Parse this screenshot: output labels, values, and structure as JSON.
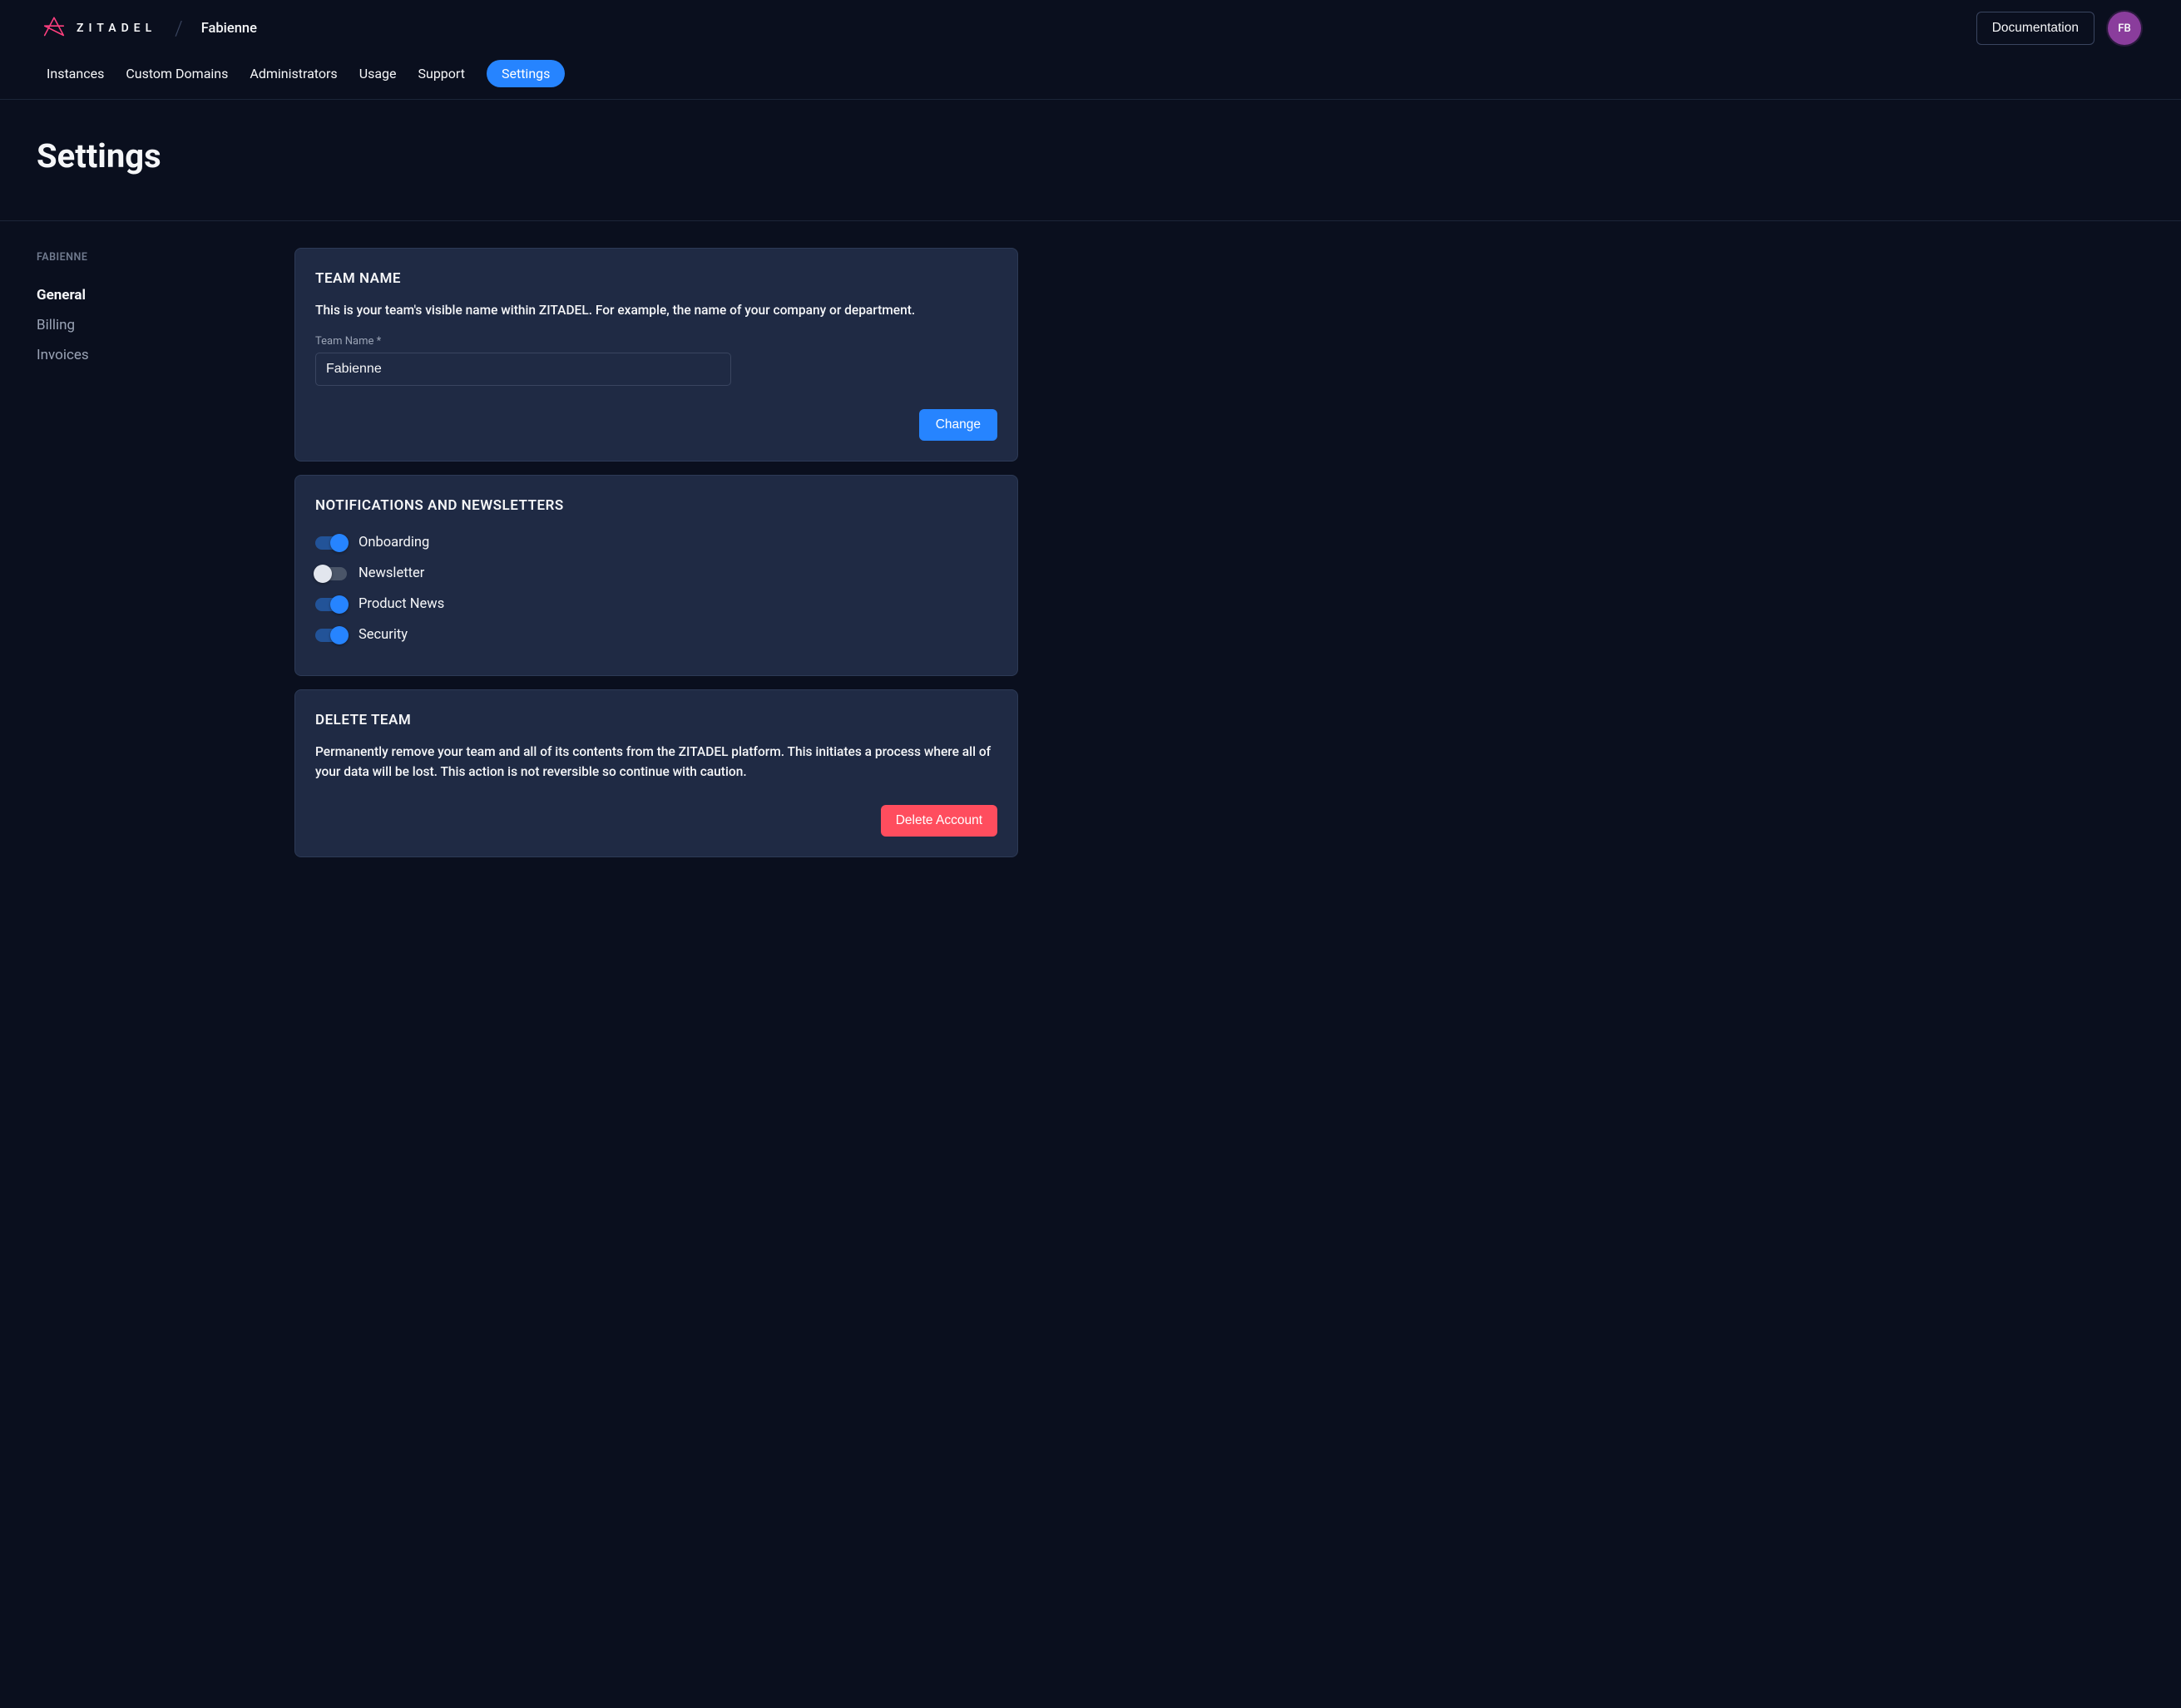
{
  "header": {
    "brand_text": "ZITADEL",
    "breadcrumb": "Fabienne",
    "documentation_label": "Documentation",
    "avatar_initials": "FB"
  },
  "nav": {
    "items": [
      {
        "label": "Instances",
        "active": false
      },
      {
        "label": "Custom Domains",
        "active": false
      },
      {
        "label": "Administrators",
        "active": false
      },
      {
        "label": "Usage",
        "active": false
      },
      {
        "label": "Support",
        "active": false
      },
      {
        "label": "Settings",
        "active": true
      }
    ]
  },
  "page": {
    "title": "Settings"
  },
  "sidebar": {
    "heading": "FABIENNE",
    "items": [
      {
        "label": "General",
        "active": true
      },
      {
        "label": "Billing",
        "active": false
      },
      {
        "label": "Invoices",
        "active": false
      }
    ]
  },
  "team_name_card": {
    "title": "TEAM NAME",
    "description": "This is your team's visible name within ZITADEL. For example, the name of your company or department.",
    "field_label": "Team Name *",
    "field_value": "Fabienne",
    "change_button": "Change"
  },
  "notifications_card": {
    "title": "NOTIFICATIONS AND NEWSLETTERS",
    "items": [
      {
        "label": "Onboarding",
        "on": true
      },
      {
        "label": "Newsletter",
        "on": false
      },
      {
        "label": "Product News",
        "on": true
      },
      {
        "label": "Security",
        "on": true
      }
    ]
  },
  "delete_card": {
    "title": "DELETE TEAM",
    "description": "Permanently remove your team and all of its contents from the ZITADEL platform. This initiates a process where all of your data will be lost. This action is not reversible so continue with caution.",
    "button": "Delete Account"
  }
}
